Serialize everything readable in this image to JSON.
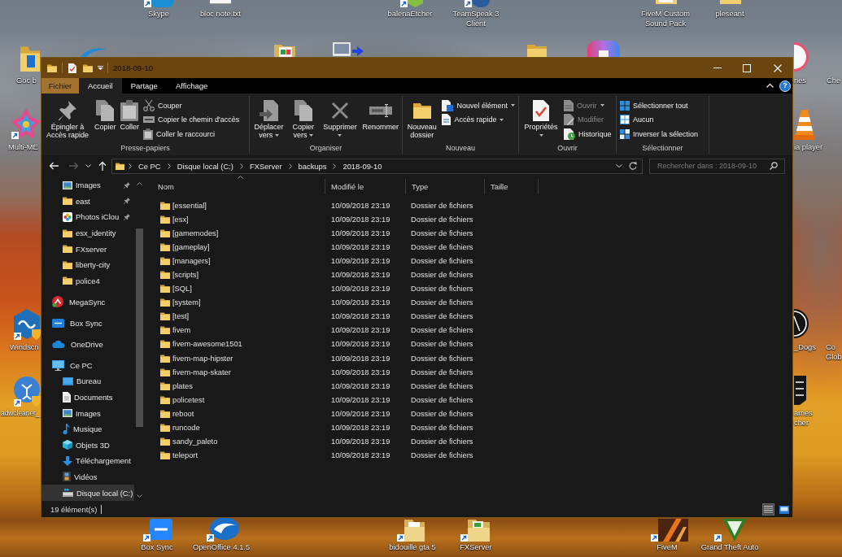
{
  "desktop": {
    "icons": [
      {
        "lines": [
          "Skype"
        ]
      },
      {
        "lines": [
          "bloc note.txt"
        ]
      },
      {
        "lines": [
          "balenaEtcher"
        ]
      },
      {
        "lines": [
          "TeamSpeak 3",
          "Client"
        ]
      },
      {
        "lines": [
          "FiveM Custom",
          "Sound Pack"
        ]
      },
      {
        "lines": [
          "pleseant"
        ]
      },
      {
        "lines": [
          "Goc b"
        ]
      },
      {
        "lines": [
          "nes"
        ]
      },
      {
        "lines": [
          "Che"
        ]
      },
      {
        "lines": [
          "Multi-ME"
        ]
      },
      {
        "lines": [
          "ia player"
        ]
      },
      {
        "lines": [
          "Windscri"
        ]
      },
      {
        "lines": [
          "_Dogs"
        ]
      },
      {
        "lines": [
          "Co",
          "Glob"
        ]
      },
      {
        "lines": [
          "adwcleaner_"
        ]
      },
      {
        "lines": [
          "ames",
          "cher"
        ]
      },
      {
        "lines": [
          "Box Sync"
        ]
      },
      {
        "lines": [
          "OpenOffice 4.1.5"
        ]
      },
      {
        "lines": [
          "bidouille gta 5"
        ]
      },
      {
        "lines": [
          "FXServer"
        ]
      },
      {
        "lines": [
          "FiveM"
        ]
      },
      {
        "lines": [
          "Grand Theft Auto"
        ]
      }
    ]
  },
  "window": {
    "title": "2018-09-10",
    "ribbon_tabs": [
      {
        "label": "Fichier",
        "kind": "backstage",
        "selected": false
      },
      {
        "label": "Accueil",
        "kind": "tab",
        "selected": true
      },
      {
        "label": "Partage",
        "kind": "tab",
        "selected": false
      },
      {
        "label": "Affichage",
        "kind": "tab",
        "selected": false
      }
    ],
    "help_button": {
      "label": "?"
    },
    "ribbon_groups": [
      {
        "label": "Presse-papiers",
        "buttons": [
          {
            "kind": "large",
            "label": "Épingler à Accès rapide",
            "dropdown": false,
            "disabled": false
          },
          {
            "kind": "large",
            "label": "Copier",
            "dropdown": false,
            "disabled": false
          },
          {
            "kind": "large",
            "label": "Coller",
            "dropdown": false,
            "disabled": false
          },
          {
            "kind": "small",
            "label": "Couper",
            "dropdown": false,
            "disabled": false
          },
          {
            "kind": "small",
            "label": "Copier le chemin d'accès",
            "dropdown": false,
            "disabled": false
          },
          {
            "kind": "small",
            "label": "Coller le raccourci",
            "dropdown": false,
            "disabled": false
          }
        ]
      },
      {
        "label": "Organiser",
        "buttons": [
          {
            "kind": "large",
            "label": "Déplacer vers",
            "dropdown": true,
            "disabled": false
          },
          {
            "kind": "large",
            "label": "Copier vers",
            "dropdown": true,
            "disabled": false
          },
          {
            "kind": "large",
            "label": "Supprimer",
            "dropdown": true,
            "disabled": false
          },
          {
            "kind": "large",
            "label": "Renommer",
            "dropdown": false,
            "disabled": false
          }
        ]
      },
      {
        "label": "Nouveau",
        "buttons": [
          {
            "kind": "large",
            "label": "Nouveau dossier",
            "dropdown": false,
            "disabled": false
          },
          {
            "kind": "small",
            "label": "Nouvel élément",
            "dropdown": true,
            "disabled": false
          },
          {
            "kind": "small",
            "label": "Accès rapide",
            "dropdown": true,
            "disabled": false
          }
        ]
      },
      {
        "label": "Ouvrir",
        "buttons": [
          {
            "kind": "large",
            "label": "Propriétés",
            "dropdown": true,
            "disabled": false
          },
          {
            "kind": "small",
            "label": "Ouvrir",
            "dropdown": true,
            "disabled": true
          },
          {
            "kind": "small",
            "label": "Modifier",
            "dropdown": false,
            "disabled": true
          },
          {
            "kind": "small",
            "label": "Historique",
            "dropdown": false,
            "disabled": false
          }
        ]
      },
      {
        "label": "Sélectionner",
        "buttons": [
          {
            "kind": "small",
            "label": "Sélectionner tout",
            "dropdown": false,
            "disabled": false
          },
          {
            "kind": "small",
            "label": "Aucun",
            "dropdown": false,
            "disabled": false
          },
          {
            "kind": "small",
            "label": "Inverser la sélection",
            "dropdown": false,
            "disabled": false
          }
        ]
      }
    ],
    "navigation": [
      {
        "kind": "back",
        "disabled": false
      },
      {
        "kind": "forward",
        "disabled": true
      },
      {
        "kind": "recent",
        "disabled": false
      },
      {
        "kind": "up",
        "disabled": false
      }
    ],
    "address_bar": {
      "segments": [
        "Ce PC",
        "Disque local (C:)",
        "FXServer",
        "backups",
        "2018-09-10"
      ]
    },
    "search": {
      "placeholder": "Rechercher dans : 2018-09-10"
    },
    "nav_pane": {
      "quick_access": [
        {
          "label": "Images",
          "pinned": true,
          "selected": false
        },
        {
          "label": "east",
          "pinned": true,
          "selected": false
        },
        {
          "label": "Photos iClou",
          "pinned": true,
          "selected": false
        },
        {
          "label": "esx_identity",
          "pinned": false,
          "selected": false
        },
        {
          "label": "FXserver",
          "pinned": false,
          "selected": false
        },
        {
          "label": "liberty-city",
          "pinned": false,
          "selected": false
        },
        {
          "label": "police4",
          "pinned": false,
          "selected": false
        }
      ],
      "items": [
        {
          "label": "MegaSync",
          "selected": false
        },
        {
          "label": "Box Sync",
          "selected": false
        },
        {
          "label": "OneDrive",
          "selected": false
        },
        {
          "label": "Ce PC",
          "selected": false,
          "children": [
            {
              "label": "Bureau",
              "selected": false
            },
            {
              "label": "Documents",
              "selected": false
            },
            {
              "label": "Images",
              "selected": false
            },
            {
              "label": "Musique",
              "selected": false
            },
            {
              "label": "Objets 3D",
              "selected": false
            },
            {
              "label": "Téléchargement",
              "selected": false
            },
            {
              "label": "Vidéos",
              "selected": false
            },
            {
              "label": "Disque local (C:)",
              "selected": true
            }
          ]
        }
      ]
    },
    "file_list": {
      "columns": [
        {
          "label": "Nom",
          "sorted": true
        },
        {
          "label": "Modifié le",
          "sorted": false
        },
        {
          "label": "Type",
          "sorted": false
        },
        {
          "label": "Taille",
          "sorted": false
        }
      ],
      "rows": [
        {
          "name": "[essential]",
          "modified": "10/09/2018 23:19",
          "type": "Dossier de fichiers"
        },
        {
          "name": "[esx]",
          "modified": "10/09/2018 23:19",
          "type": "Dossier de fichiers"
        },
        {
          "name": "[gamemodes]",
          "modified": "10/09/2018 23:19",
          "type": "Dossier de fichiers"
        },
        {
          "name": "[gameplay]",
          "modified": "10/09/2018 23:19",
          "type": "Dossier de fichiers"
        },
        {
          "name": "[managers]",
          "modified": "10/09/2018 23:19",
          "type": "Dossier de fichiers"
        },
        {
          "name": "[scripts]",
          "modified": "10/09/2018 23:19",
          "type": "Dossier de fichiers"
        },
        {
          "name": "[SQL]",
          "modified": "10/09/2018 23:19",
          "type": "Dossier de fichiers"
        },
        {
          "name": "[system]",
          "modified": "10/09/2018 23:19",
          "type": "Dossier de fichiers"
        },
        {
          "name": "[test]",
          "modified": "10/09/2018 23:19",
          "type": "Dossier de fichiers"
        },
        {
          "name": "fivem",
          "modified": "10/09/2018 23:19",
          "type": "Dossier de fichiers"
        },
        {
          "name": "fivem-awesome1501",
          "modified": "10/09/2018 23:19",
          "type": "Dossier de fichiers"
        },
        {
          "name": "fivem-map-hipster",
          "modified": "10/09/2018 23:19",
          "type": "Dossier de fichiers"
        },
        {
          "name": "fivem-map-skater",
          "modified": "10/09/2018 23:19",
          "type": "Dossier de fichiers"
        },
        {
          "name": "plates",
          "modified": "10/09/2018 23:19",
          "type": "Dossier de fichiers"
        },
        {
          "name": "policetest",
          "modified": "10/09/2018 23:19",
          "type": "Dossier de fichiers"
        },
        {
          "name": "reboot",
          "modified": "10/09/2018 23:19",
          "type": "Dossier de fichiers"
        },
        {
          "name": "runcode",
          "modified": "10/09/2018 23:19",
          "type": "Dossier de fichiers"
        },
        {
          "name": "sandy_paleto",
          "modified": "10/09/2018 23:19",
          "type": "Dossier de fichiers"
        },
        {
          "name": "teleport",
          "modified": "10/09/2018 23:19",
          "type": "Dossier de fichiers"
        }
      ]
    },
    "status_bar": {
      "item_count": "19 élément(s)",
      "views": [
        {
          "selected": true
        },
        {
          "selected": false
        }
      ]
    }
  }
}
